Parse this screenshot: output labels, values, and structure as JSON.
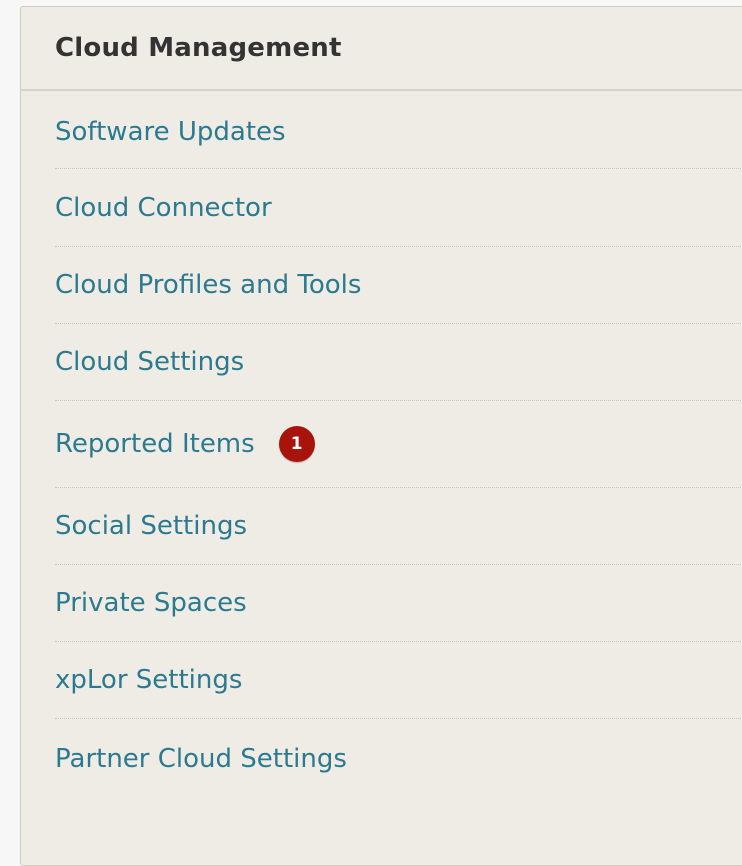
{
  "panel": {
    "title": "Cloud Management",
    "items": [
      {
        "label": "Software Updates"
      },
      {
        "label": "Cloud Connector"
      },
      {
        "label": "Cloud Profiles and Tools"
      },
      {
        "label": "Cloud Settings"
      },
      {
        "label": "Reported Items",
        "badge": "1"
      },
      {
        "label": "Social Settings"
      },
      {
        "label": "Private Spaces"
      },
      {
        "label": "xpLor Settings"
      },
      {
        "label": "Partner Cloud Settings"
      }
    ]
  },
  "colors": {
    "panel_background": "#efece6",
    "link": "#2b7a8f",
    "title": "#333333",
    "badge": "#a8140c"
  }
}
